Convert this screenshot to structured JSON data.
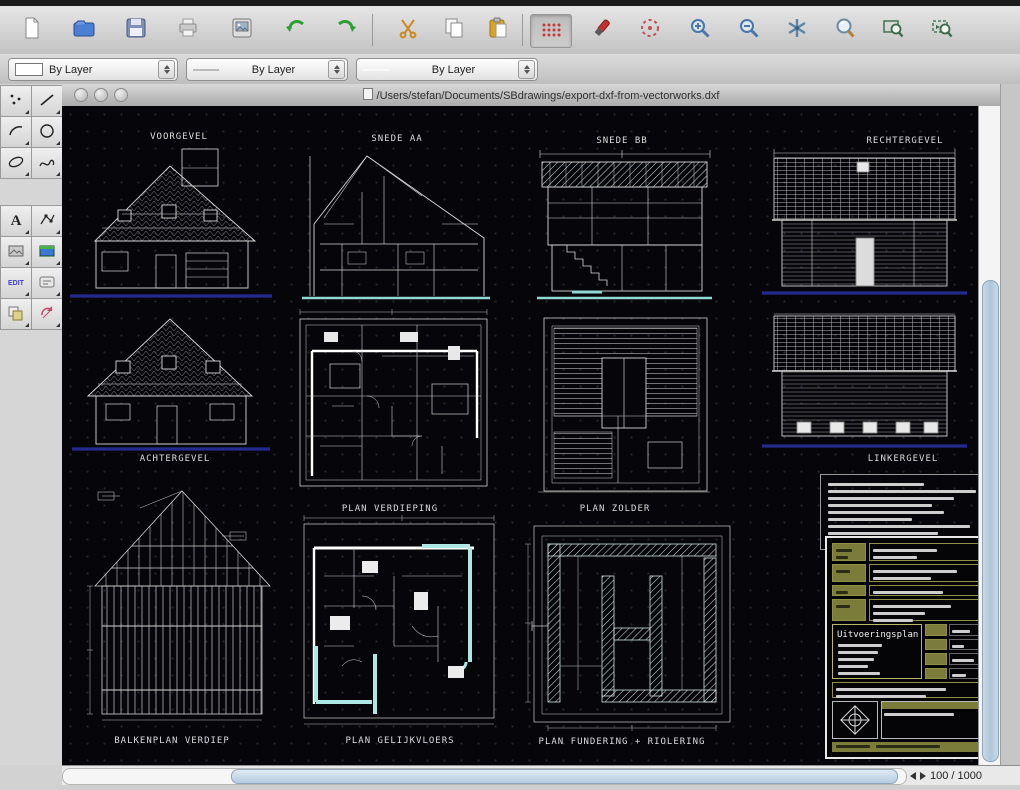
{
  "window": {
    "title": "/Users/stefan/Documents/SBdrawings/export-dxf-from-vectorworks.dxf"
  },
  "toolbar": {
    "icons": [
      "new-document",
      "open",
      "save",
      "print",
      "export-image",
      "undo",
      "redo",
      "cut",
      "copy",
      "paste",
      "grid-toggle",
      "eraser",
      "snap",
      "zoom-in",
      "zoom-out",
      "pan-star",
      "magnify",
      "zoom-window",
      "zoom-previous"
    ]
  },
  "layer_dropdowns": [
    {
      "label": "By Layer"
    },
    {
      "label": "By Layer"
    },
    {
      "label": "By Layer"
    }
  ],
  "palette": {
    "edit_label": "EDIT",
    "tools": [
      "points",
      "line",
      "arc",
      "circle",
      "ellipse",
      "spline",
      "text",
      "nodes",
      "image",
      "viewport",
      "edit",
      "edit-attributes",
      "duplicate",
      "rotate"
    ]
  },
  "canvas": {
    "labels": {
      "voorgevel": "VOORGEVEL",
      "snede_aa": "SNEDE AA",
      "snede_bb": "SNEDE BB",
      "rechtergevel": "RECHTERGEVEL",
      "achtergevel": "ACHTERGEVEL",
      "plan_verdieping": "PLAN VERDIEPING",
      "plan_zolder": "PLAN ZOLDER",
      "linkergevel": "LINKERGEVEL",
      "balkenplan_verdiep": "BALKENPLAN VERDIEP",
      "plan_gelijkvloers": "PLAN GELIJKVLOERS",
      "plan_fundering": "PLAN FUNDERING + RIOLERING"
    },
    "title_block": {
      "plan_name": "Uitvoeringsplan"
    }
  },
  "statusbar": {
    "zoom_indicator": "100 / 1000"
  },
  "colors": {
    "line_white": "#e2e2e2",
    "accent_cyan": "#9fe3de",
    "ground_navy": "#242b8e",
    "titleblock_olive": "#7c7c3a",
    "grid_dot_red": "#c23a3a"
  }
}
